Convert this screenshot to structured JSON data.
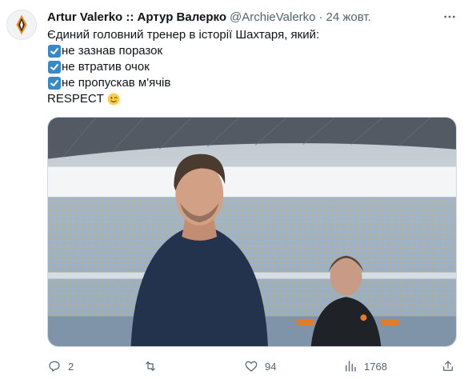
{
  "tweet": {
    "display_name": "Artur Valerko :: Артур Валерко",
    "handle": "@ArchieValerko",
    "separator": "·",
    "time": "24 жовт.",
    "intro": "Єдиний головний тренер в історії Шахтаря, який:",
    "list": [
      "не зазнав поразок",
      "не втратив очок",
      "не пропускав м'ячів"
    ],
    "closing": "RESPECT",
    "icons": {
      "more": "more-horizontal-icon",
      "check": "check-box-icon",
      "emoji": "winking-face-emoji"
    }
  },
  "colors": {
    "accent_check": "#3b88c3",
    "muted": "#536471",
    "text": "#0f1419"
  },
  "actions": {
    "replies": "2",
    "retweets": "",
    "likes": "94",
    "views": "1768"
  }
}
